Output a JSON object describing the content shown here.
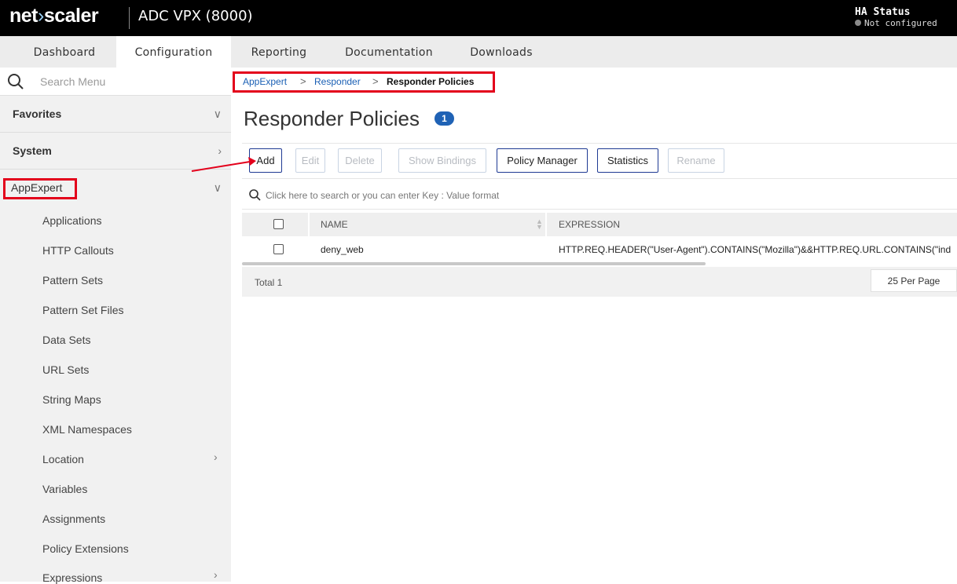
{
  "header": {
    "logo_main": "net",
    "logo_arrow": "›",
    "logo_end": "scaler",
    "product": "ADC VPX (8000)",
    "ha_title": "HA Status",
    "ha_status": "Not configured"
  },
  "nav": {
    "tabs": [
      {
        "label": "Dashboard"
      },
      {
        "label": "Configuration"
      },
      {
        "label": "Reporting"
      },
      {
        "label": "Documentation"
      },
      {
        "label": "Downloads"
      }
    ]
  },
  "sidebar": {
    "search_placeholder": "Search Menu",
    "sections": [
      {
        "label": "Favorites"
      },
      {
        "label": "System"
      },
      {
        "label": "AppExpert"
      }
    ],
    "items": [
      {
        "label": "Applications"
      },
      {
        "label": "HTTP Callouts"
      },
      {
        "label": "Pattern Sets"
      },
      {
        "label": "Pattern Set Files"
      },
      {
        "label": "Data Sets"
      },
      {
        "label": "URL Sets"
      },
      {
        "label": "String Maps"
      },
      {
        "label": "XML Namespaces"
      },
      {
        "label": "Location"
      },
      {
        "label": "Variables"
      },
      {
        "label": "Assignments"
      },
      {
        "label": "Policy Extensions"
      },
      {
        "label": "Expressions"
      }
    ]
  },
  "breadcrumb": [
    "AppExpert",
    "Responder",
    "Responder Policies"
  ],
  "page": {
    "title": "Responder Policies",
    "count": "1"
  },
  "toolbar": {
    "add": "Add",
    "edit": "Edit",
    "delete": "Delete",
    "show_bindings": "Show Bindings",
    "policy_manager": "Policy Manager",
    "statistics": "Statistics",
    "rename": "Rename"
  },
  "table": {
    "search_placeholder": "Click here to search or you can enter Key : Value format",
    "columns": [
      "NAME",
      "EXPRESSION"
    ],
    "rows": [
      {
        "name": "deny_web",
        "expression": "HTTP.REQ.HEADER(\"User-Agent\").CONTAINS(\"Mozilla\")&&HTTP.REQ.URL.CONTAINS(\"ind"
      }
    ],
    "total": "Total 1",
    "per_page": "25 Per Page"
  },
  "colors": {
    "highlight": "#e3001b",
    "accent": "#1f62b5"
  }
}
